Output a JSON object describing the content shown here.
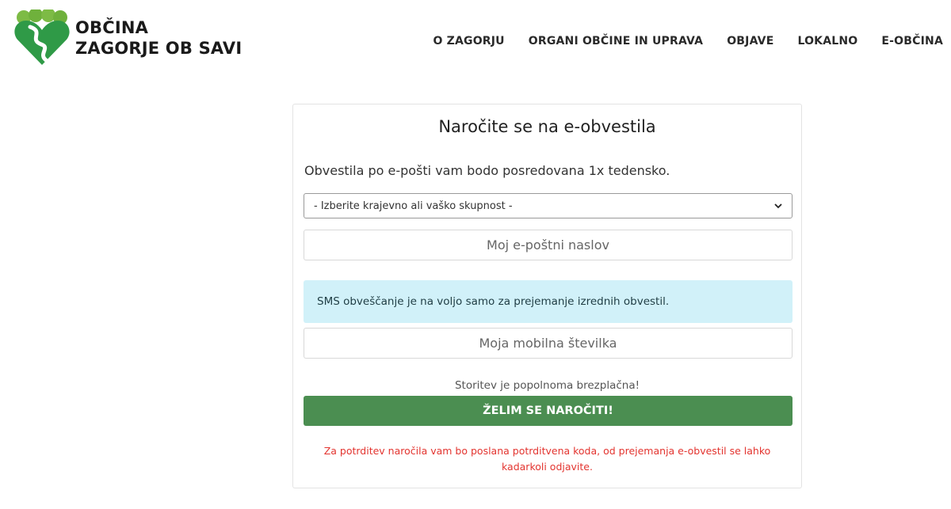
{
  "header": {
    "brand_line1": "OBČINA",
    "brand_line2": "ZAGORJE OB SAVI",
    "nav": [
      "O ZAGORJU",
      "ORGANI OBČINE IN UPRAVA",
      "OBJAVE",
      "LOKALNO",
      "E-OBČINA"
    ]
  },
  "form": {
    "title": "Naročite se na e-obvestila",
    "intro": "Obvestila po e-pošti vam bodo posredovana 1x tedensko.",
    "select_value": "- Izberite krajevno ali vaško skupnost -",
    "email_placeholder": "Moj e-poštni naslov",
    "sms_info": "SMS obveščanje je na voljo samo za prejemanje izrednih obvestil.",
    "phone_placeholder": "Moja mobilna številka",
    "free_text": "Storitev je popolnoma brezplačna!",
    "submit_label": "ŽELIM SE NAROČITI!",
    "confirm_note": "Za potrditev naročila vam bo poslana potrditvena koda, od prejemanja e-obvestil se lahko kadarkoli odjavite."
  },
  "icons": {
    "logo": "heart-river-logo",
    "select": "chevron-down-icon"
  },
  "colors": {
    "accent_green": "#4b8e51",
    "alert_bg": "#d1f1f9",
    "warning_red": "#e3342f"
  }
}
